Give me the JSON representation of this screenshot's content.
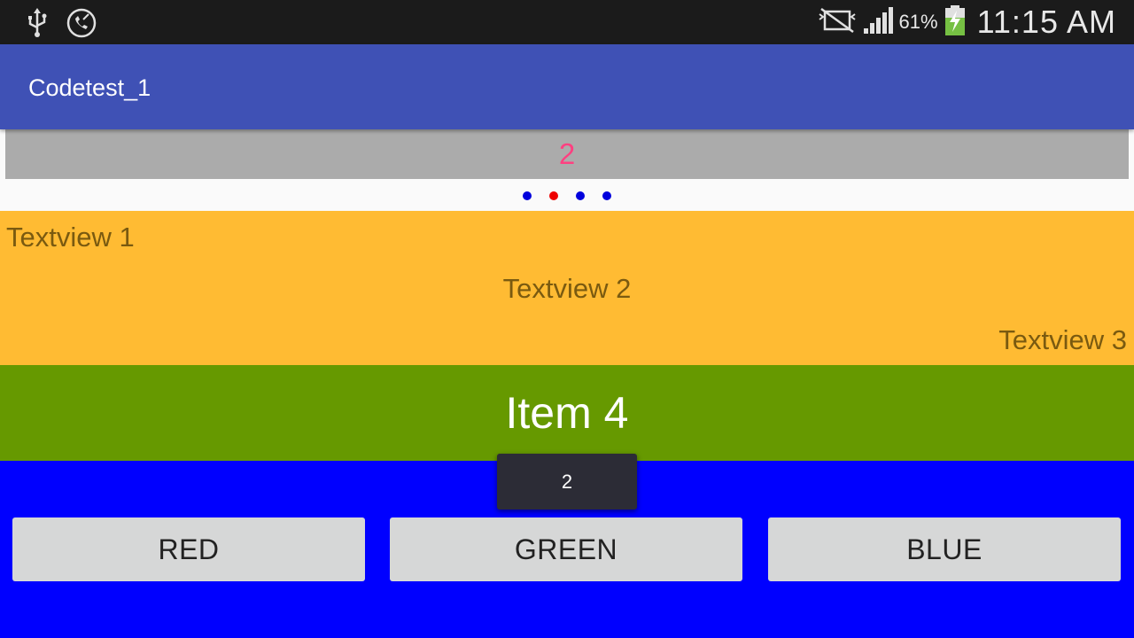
{
  "status_bar": {
    "time": "11:15 AM",
    "battery_percent": "61%",
    "icons": [
      "usb-icon",
      "call-icon",
      "no-sim-icon",
      "signal-icon",
      "battery-charging-icon"
    ]
  },
  "action_bar": {
    "title": "Codetest_1"
  },
  "pager": {
    "current_label": "2",
    "dot_count": 4,
    "active_index": 1
  },
  "textviews": {
    "tv1": "Textview 1",
    "tv2": "Textview 2",
    "tv3": "Textview 3"
  },
  "item": {
    "label": "Item 4"
  },
  "toast": {
    "text": "2"
  },
  "buttons": {
    "red": "RED",
    "green": "GREEN",
    "blue": "BLUE"
  },
  "colors": {
    "action_bar": "#3f51b5",
    "accent": "#ff4081",
    "orange_panel": "#ffbb33",
    "green_panel": "#669900",
    "background": "#0000ff"
  }
}
